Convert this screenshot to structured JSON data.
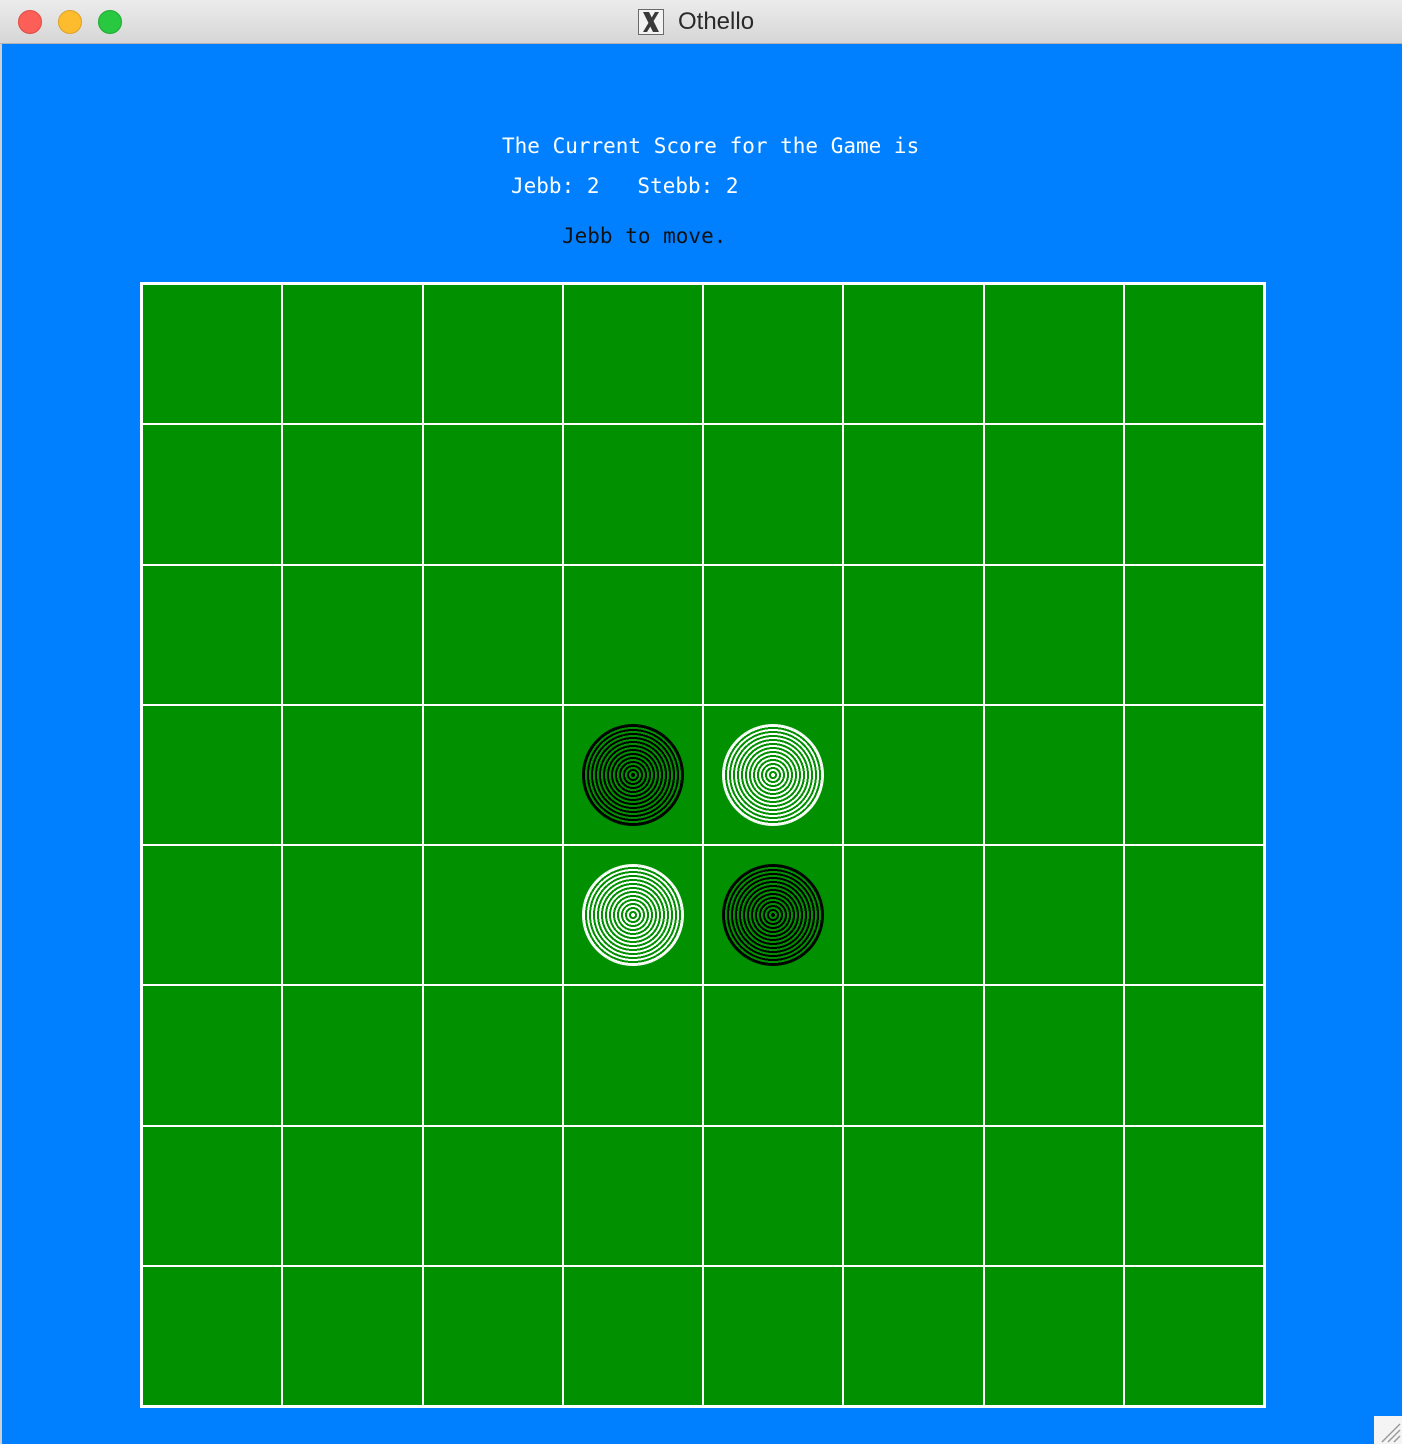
{
  "window": {
    "title": "Othello",
    "app_icon": "x11-icon",
    "background_color": "#0080ff"
  },
  "score": {
    "heading": "The Current Score for the Game is",
    "line": "Jebb: 2   Stebb: 2",
    "players": [
      {
        "name": "Jebb",
        "score": 2
      },
      {
        "name": "Stebb",
        "score": 2
      }
    ]
  },
  "turn": {
    "text": "Jebb to move."
  },
  "board": {
    "rows": 8,
    "cols": 8,
    "board_color": "#009000",
    "line_color": "#ffffff",
    "pieces": [
      {
        "row": 3,
        "col": 3,
        "color": "black"
      },
      {
        "row": 3,
        "col": 4,
        "color": "white"
      },
      {
        "row": 4,
        "col": 3,
        "color": "white"
      },
      {
        "row": 4,
        "col": 4,
        "color": "black"
      }
    ]
  }
}
